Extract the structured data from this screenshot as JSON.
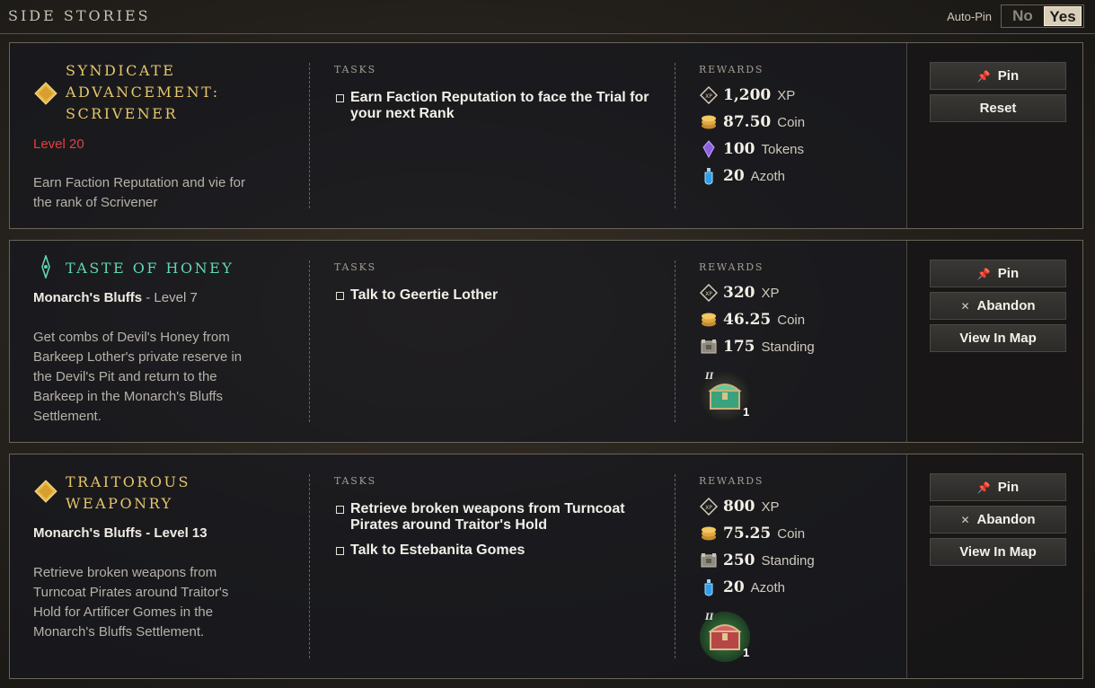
{
  "header": {
    "title": "SIDE STORIES",
    "autopin_label": "Auto-Pin",
    "toggle_no": "No",
    "toggle_yes": "Yes"
  },
  "labels": {
    "tasks": "TASKS",
    "rewards": "REWARDS"
  },
  "quests": [
    {
      "title_line1": "SYNDICATE",
      "title_line2": "ADVANCEMENT:",
      "title_line3": "SCRIVENER",
      "level": "Level 20",
      "description": "Earn Faction Reputation and vie for the rank of Scrivener",
      "tasks": [
        "Earn Faction Reputation to face the Trial for your next Rank"
      ],
      "rewards": [
        {
          "icon": "xp-icon",
          "value": "1,200",
          "unit": "XP"
        },
        {
          "icon": "coin-icon",
          "value": "87.50",
          "unit": "Coin"
        },
        {
          "icon": "token-icon",
          "value": "100",
          "unit": "Tokens"
        },
        {
          "icon": "azoth-icon",
          "value": "20",
          "unit": "Azoth"
        }
      ],
      "buttons": {
        "pin": "Pin",
        "reset": "Reset"
      }
    },
    {
      "title_line1": "TASTE OF HONEY",
      "location": "Monarch's Bluffs",
      "level": "- Level 7",
      "description": "Get combs of Devil's Honey from Barkeep Lother's private reserve in the Devil's Pit and return to the Barkeep in the Monarch's Bluffs Settlement.",
      "tasks": [
        "Talk to Geertie Lother"
      ],
      "rewards": [
        {
          "icon": "xp-icon",
          "value": "320",
          "unit": "XP"
        },
        {
          "icon": "coin-icon",
          "value": "46.25",
          "unit": "Coin"
        },
        {
          "icon": "standing-icon",
          "value": "175",
          "unit": "Standing"
        }
      ],
      "chest": {
        "tier": "II",
        "count": "1"
      },
      "buttons": {
        "pin": "Pin",
        "abandon": "Abandon",
        "map": "View In Map"
      }
    },
    {
      "title_line1": "TRAITOROUS",
      "title_line2": "WEAPONRY",
      "location": "Monarch's Bluffs",
      "level": "- Level 13",
      "description": "Retrieve broken weapons from Turncoat Pirates around Traitor's Hold for Artificer Gomes in the Monarch's Bluffs Settlement.",
      "tasks": [
        "Retrieve broken weapons from Turncoat Pirates around Traitor's Hold",
        "Talk to Estebanita Gomes"
      ],
      "rewards": [
        {
          "icon": "xp-icon",
          "value": "800",
          "unit": "XP"
        },
        {
          "icon": "coin-icon",
          "value": "75.25",
          "unit": "Coin"
        },
        {
          "icon": "standing-icon",
          "value": "250",
          "unit": "Standing"
        },
        {
          "icon": "azoth-icon",
          "value": "20",
          "unit": "Azoth"
        }
      ],
      "chest": {
        "tier": "II",
        "count": "1"
      },
      "buttons": {
        "pin": "Pin",
        "abandon": "Abandon",
        "map": "View In Map"
      }
    }
  ],
  "colors": {
    "gold": "#e7c56a",
    "teal": "#5fd7b4",
    "level_red": "#e2403f"
  }
}
